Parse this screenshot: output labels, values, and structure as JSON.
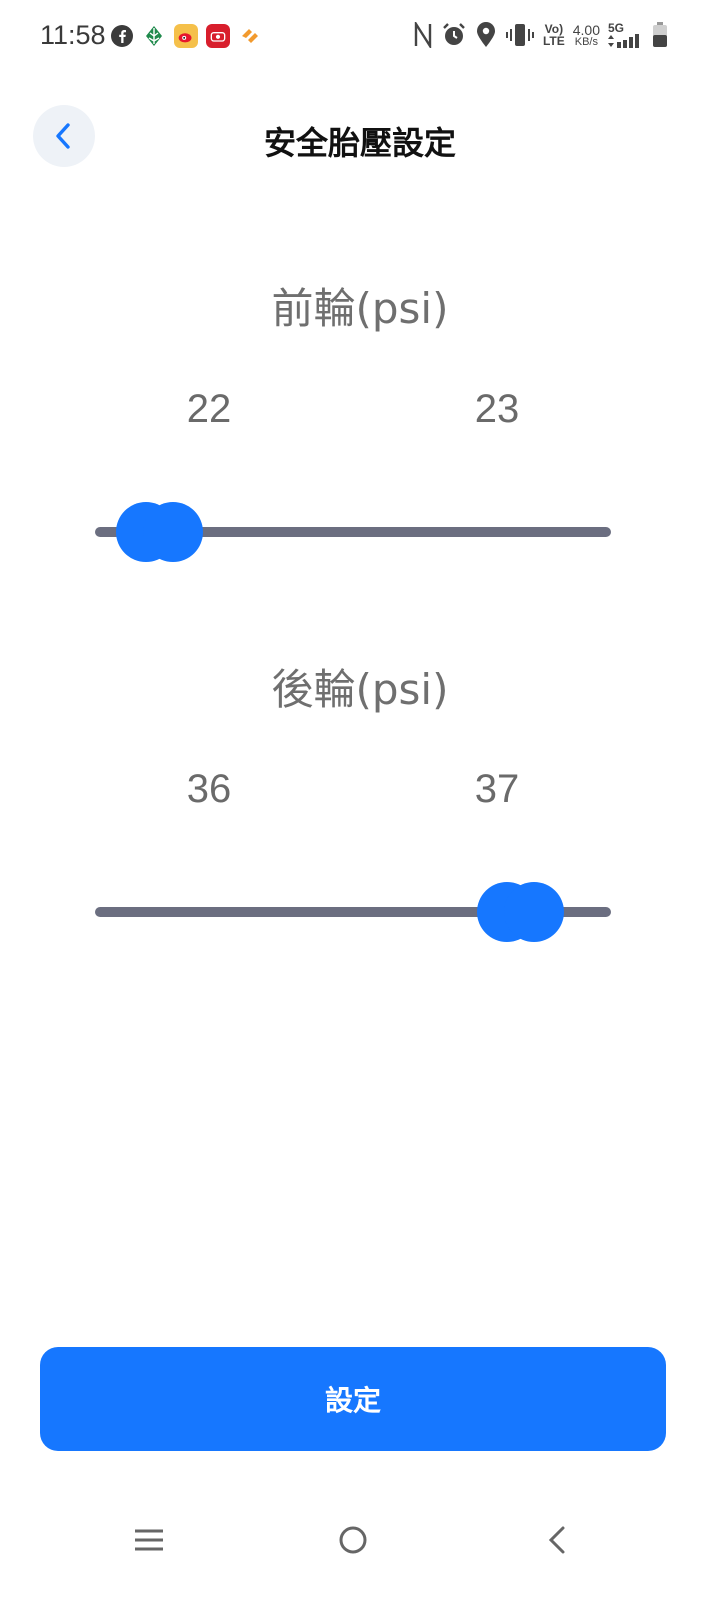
{
  "status_bar": {
    "time": "11:58",
    "notification_icons": [
      "facebook-icon",
      "leaf-app-icon",
      "weibo-icon",
      "red-app-icon",
      "orange-heart-app-icon"
    ],
    "lte_top": "Vo)",
    "lte_bottom": "LTE",
    "speed_value": "4.00",
    "speed_unit": "KB/s",
    "network_type": "5G"
  },
  "header": {
    "title": "安全胎壓設定",
    "back_icon": "chevron-left-icon"
  },
  "front": {
    "label": "前輪(psi)",
    "min_value": "22",
    "max_value": "23"
  },
  "rear": {
    "label": "後輪(psi)",
    "min_value": "36",
    "max_value": "37"
  },
  "action": {
    "submit_label": "設定"
  },
  "nav_bar": {
    "icons": [
      "menu-icon",
      "home-circle-icon",
      "back-chevron-icon"
    ]
  },
  "colors": {
    "accent": "#1677ff",
    "track": "#6b6e80",
    "label": "#6f6f6f"
  }
}
